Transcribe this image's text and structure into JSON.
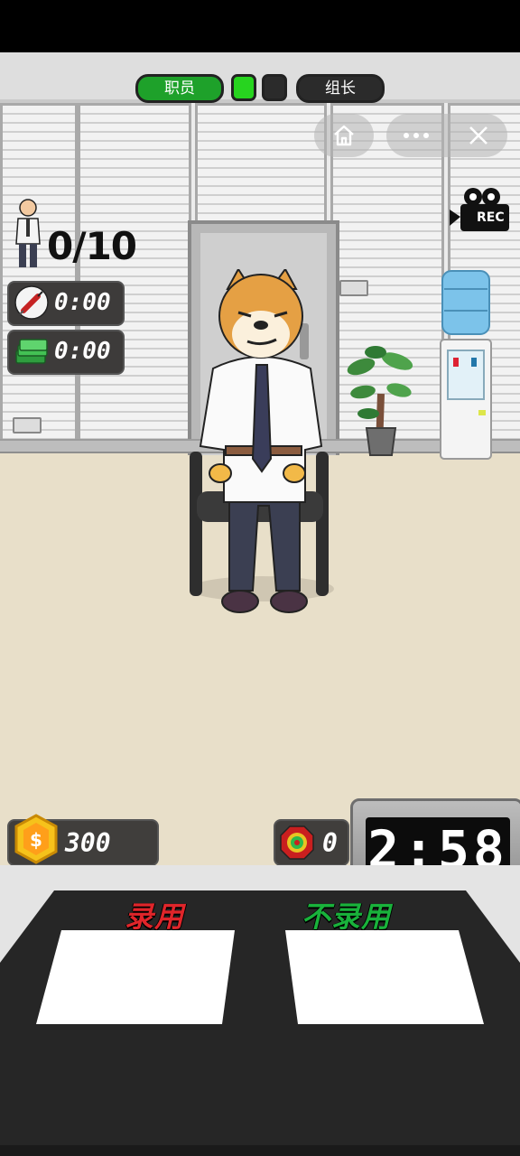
{
  "rank": {
    "current_label": "职员",
    "next_label": "组长",
    "progress_steps": [
      true,
      false
    ],
    "colors": {
      "current": "#1ea12a",
      "step_filled": "#27d41f",
      "step_empty": "#2b2b2b",
      "next": "#2b2b2b"
    }
  },
  "mini_program": {
    "home_icon": "home-icon",
    "more_icon": "more-dots-icon",
    "close_icon": "close-icon"
  },
  "hud": {
    "hired_count": "0/10",
    "syringe_timer": "0:00",
    "money_timer": "0:00",
    "coins": "300",
    "targets": "0",
    "countdown": "2:58",
    "rec_label": "REC"
  },
  "decisions": {
    "hire_label": "录用",
    "reject_label": "不录用",
    "hire_color": "#e0252a",
    "reject_color": "#19b23b"
  }
}
